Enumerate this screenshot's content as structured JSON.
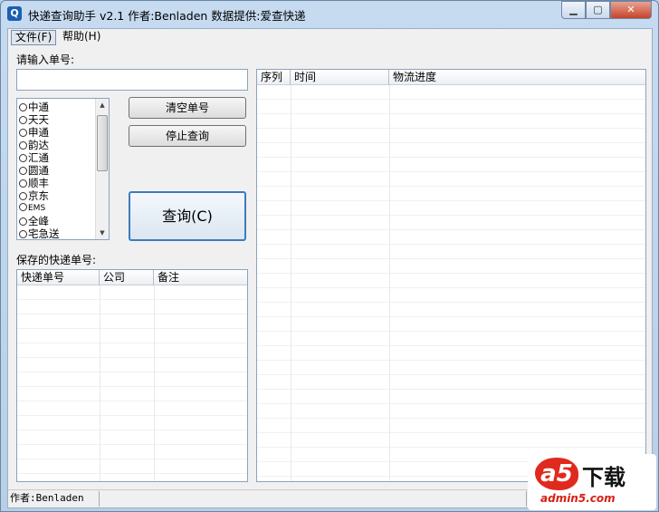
{
  "window": {
    "app_icon": "Q",
    "title": "快递查询助手 v2.1  作者:Benladen 数据提供:爱查快递",
    "minimize_icon": "▁",
    "maximize_icon": "▢",
    "close_icon": "✕"
  },
  "menu": {
    "file": "文件(F)",
    "help": "帮助(H)"
  },
  "input_section": {
    "label": "请输入单号:",
    "value": ""
  },
  "couriers": [
    "中通",
    "天天",
    "申通",
    "韵达",
    "汇通",
    "圆通",
    "顺丰",
    "京东",
    "EMS",
    "全峰",
    "宅急送"
  ],
  "scroll": {
    "up_icon": "▲",
    "down_icon": "▼"
  },
  "buttons": {
    "clear": "清空单号",
    "stop": "停止查询",
    "query": "查询(C)"
  },
  "saved": {
    "label": "保存的快递单号:",
    "columns": [
      "快递单号",
      "公司",
      "备注"
    ]
  },
  "results": {
    "columns": [
      "序列",
      "时间",
      "物流进度"
    ]
  },
  "status": {
    "author": "作者:Benladen"
  },
  "watermark": {
    "logo": "a5",
    "title": "下载",
    "url": "admin5.com"
  }
}
